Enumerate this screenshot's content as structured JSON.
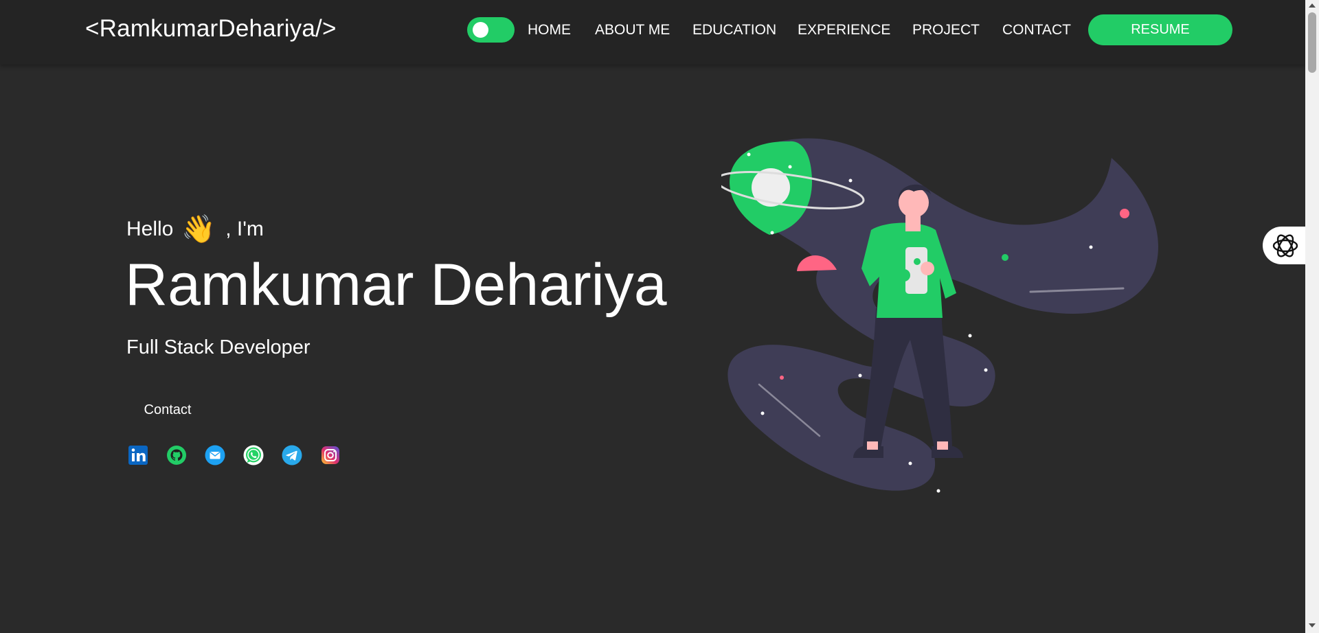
{
  "colors": {
    "accent": "#22cc66",
    "background": "#2a2a2a",
    "navbar": "#242424",
    "blob": "#3f3d56",
    "pink": "#ff6584"
  },
  "navbar": {
    "logo": "<RamkumarDehariya/>",
    "theme_toggle": {
      "state": "on"
    },
    "links": [
      "HOME",
      "ABOUT ME",
      "EDUCATION",
      "EXPERIENCE",
      "PROJECT",
      "CONTACT"
    ],
    "resume_label": "RESUME"
  },
  "hero": {
    "greeting_before": "Hello",
    "wave_emoji": "👋",
    "greeting_after": ", I'm",
    "name": "Ramkumar Dehariya",
    "role": "Full Stack Developer",
    "contact_label": "Contact"
  },
  "socials": [
    {
      "icon": "linkedin-icon"
    },
    {
      "icon": "github-icon"
    },
    {
      "icon": "email-icon"
    },
    {
      "icon": "whatsapp-icon"
    },
    {
      "icon": "telegram-icon"
    },
    {
      "icon": "instagram-icon"
    }
  ],
  "widgets": {
    "side_widget_icon": "ai-assistant-icon"
  }
}
